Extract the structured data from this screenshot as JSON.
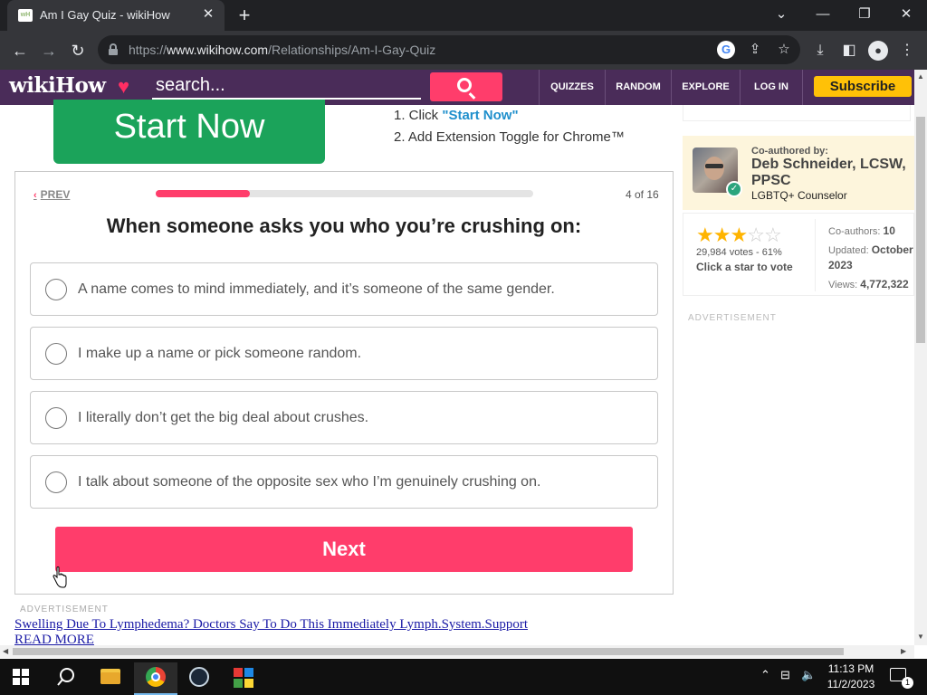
{
  "browser": {
    "tab_title": "Am I Gay Quiz - wikiHow",
    "favicon_text": "wH",
    "url_scheme": "https://",
    "url_host": "www.wikihow.com",
    "url_path": "/Relationships/Am-I-Gay-Quiz"
  },
  "header": {
    "logo": "wikiHow",
    "search_placeholder": "search...",
    "nav": [
      "QUIZZES",
      "RANDOM",
      "EXPLORE",
      "LOG IN"
    ],
    "subscribe": "Subscribe"
  },
  "promo": {
    "button": "Start Now",
    "step1_prefix": "1. Click ",
    "step1_link": "\"Start Now\"",
    "step2": "2. Add Extension Toggle for Chrome™"
  },
  "quiz": {
    "prev_label": "PREV",
    "progress_text": "4 of 16",
    "progress_fraction": 0.25,
    "question": "When someone asks you who you’re crushing on:",
    "options": [
      "A name comes to mind immediately, and it’s someone of the same gender.",
      "I make up a name or pick someone random.",
      "I literally don’t get the big deal about crushes.",
      "I talk about someone of the opposite sex who I’m genuinely crushing on."
    ],
    "next_label": "Next"
  },
  "ads": {
    "label": "ADVERTISEMENT",
    "link_text": "Swelling Due To Lymphedema? Doctors Say To Do This Immediately Lymph.System.Support",
    "more_text": "READ MORE"
  },
  "sidebar": {
    "coauthored_label": "Co-authored by:",
    "author_name": "Deb Schneider, LCSW, PPSC",
    "author_title": "LGBTQ+ Counselor",
    "rating_stars": 3,
    "rating_max": 5,
    "votes": "29,984 votes - 61%",
    "vote_cta": "Click a star to vote",
    "coauthors_label": "Co-authors:",
    "coauthors_value": "10",
    "updated_label": "Updated:",
    "updated_value": "October 2023",
    "views_label": "Views:",
    "views_value": "4,772,322",
    "ad_label": "ADVERTISEMENT"
  },
  "taskbar": {
    "time": "11:13 PM",
    "date": "11/2/2023",
    "notification_count": "1"
  },
  "colors": {
    "brand_purple": "#4a2c59",
    "accent_pink": "#ff3d6b",
    "cta_green": "#1ba35a",
    "subscribe_yellow": "#ffc107"
  }
}
